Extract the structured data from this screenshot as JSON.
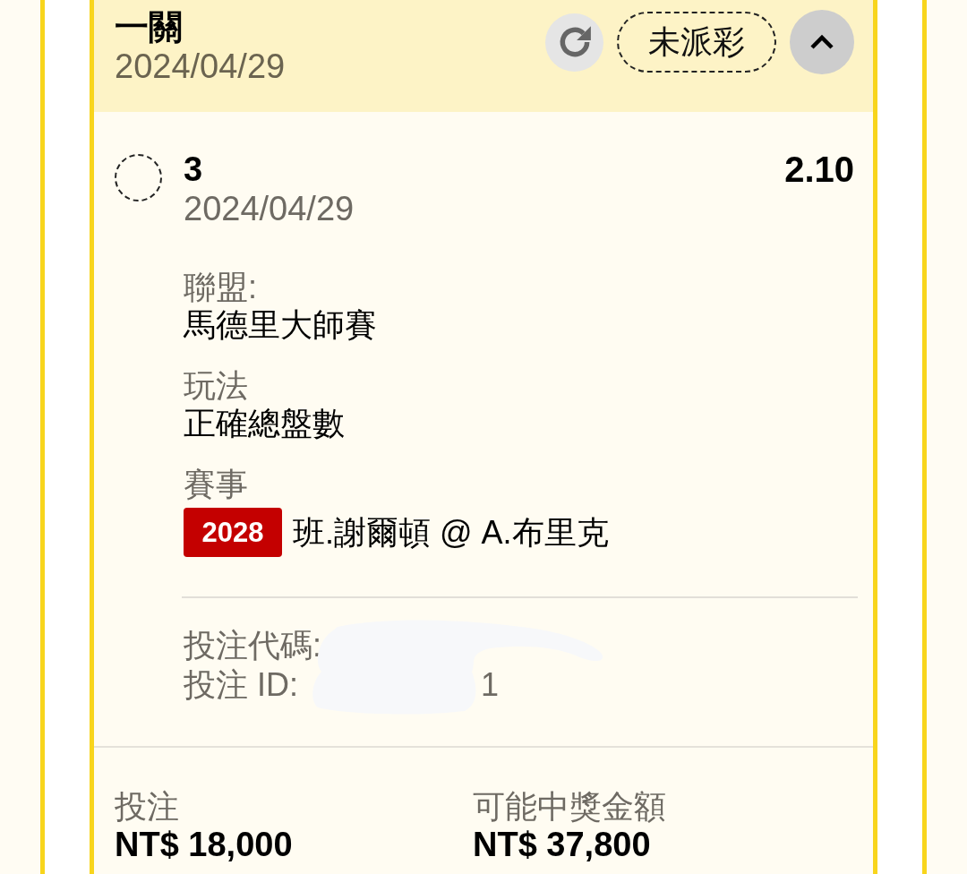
{
  "bet": {
    "type": "一關",
    "date": "2024/04/29",
    "status": "未派彩",
    "expanded": true
  },
  "selection": {
    "pick": "3",
    "date": "2024/04/29",
    "odds": "2.10",
    "details": [
      {
        "label": "聯盟:",
        "value": "馬德里大師賽"
      },
      {
        "label": "玩法",
        "value": "正確總盤數"
      },
      {
        "label": "賽事",
        "code": "2028",
        "value": "班.謝爾頓 @ A.布里克"
      }
    ]
  },
  "references": [
    {
      "label": "投注代碼:"
    },
    {
      "label": "投注 ID:",
      "value": "1"
    }
  ],
  "totals": [
    {
      "label": "投注",
      "amount": "NT$ 18,000"
    },
    {
      "label": "可能中獎金額",
      "amount": "NT$ 37,800"
    }
  ]
}
